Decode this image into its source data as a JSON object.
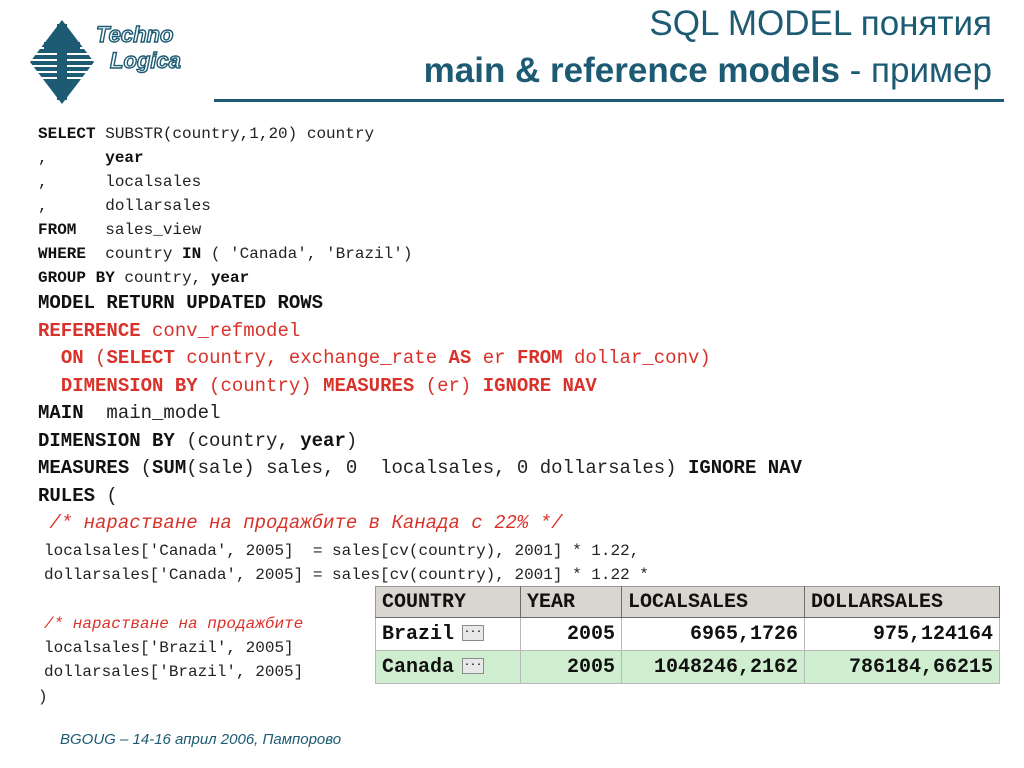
{
  "logo": {
    "icon": "technologica-logo",
    "line1": "Techno",
    "line2": "Logica"
  },
  "title": {
    "line1": "SQL MODEL понятия",
    "line2_bold": "main & reference models",
    "line2_rest": " - пример"
  },
  "code": {
    "l1_kw": "SELECT",
    "l1_rest": " SUBSTR(country,1,20) country",
    "l2_sep": ",      ",
    "l2_word": "year",
    "l3": ",      localsales",
    "l4": ",      dollarsales",
    "l5_kw": "FROM",
    "l5_rest": "   sales_view",
    "l6_kw": "WHERE",
    "l6_a": "  country ",
    "l6_in": "IN",
    "l6_b": " ( 'Canada', 'Brazil')",
    "l7_kw": "GROUP BY",
    "l7_a": " country, ",
    "l7_year": "year",
    "l8": "MODEL RETURN UPDATED ROWS",
    "l9_kw": "REFERENCE",
    "l9_rest": " conv_refmodel",
    "l10_on": "ON",
    "l10_a": " (",
    "l10_select": "SELECT",
    "l10_b": " country, exchange_rate ",
    "l10_as": "AS",
    "l10_c": " er ",
    "l10_from": "FROM",
    "l10_d": " dollar_conv)",
    "l11_dim": "DIMENSION BY",
    "l11_a": " (country) ",
    "l11_meas": "MEASURES",
    "l11_b": " (er) ",
    "l11_ign": "IGNORE NAV",
    "l12_kw": "MAIN",
    "l12_rest": "  main_model",
    "l13_kw": "DIMENSION BY",
    "l13_a": " (country, ",
    "l13_year": "year",
    "l13_b": ")",
    "l14_kw": "MEASURES",
    "l14_a": " (",
    "l14_sum": "SUM",
    "l14_b": "(sale) sales, 0  localsales, 0 dollarsales) ",
    "l14_ign": "IGNORE NAV",
    "l15_kw": "RULES",
    "l15_rest": " (",
    "l16": "/* нарастване на продажбите в Канада с 22% */",
    "l17": "localsales['Canada', 2005]  = sales[cv(country), 2001] * 1.22,",
    "l18": "dollarsales['Canada', 2005] = sales[cv(country), 2001] * 1.22 *",
    "l19": "",
    "l20": "/* нарастване на продажбите",
    "l21": "localsales['Brazil', 2005]",
    "l22": "dollarsales['Brazil', 2005]",
    "l23": ")"
  },
  "table": {
    "headers": [
      "COUNTRY",
      "YEAR",
      "LOCALSALES",
      "DOLLARSALES"
    ],
    "rows": [
      [
        "Brazil",
        "2005",
        "6965,1726",
        "975,124164"
      ],
      [
        "Canada",
        "2005",
        "1048246,2162",
        "786184,66215"
      ]
    ],
    "ellipsis": "...",
    "selected_row_color": "#cfeecf"
  },
  "footer": "BGOUG – 14-16 април 2006, Пампорово",
  "colors": {
    "title": "#1d5a73",
    "keyword_red": "#d8322a"
  }
}
